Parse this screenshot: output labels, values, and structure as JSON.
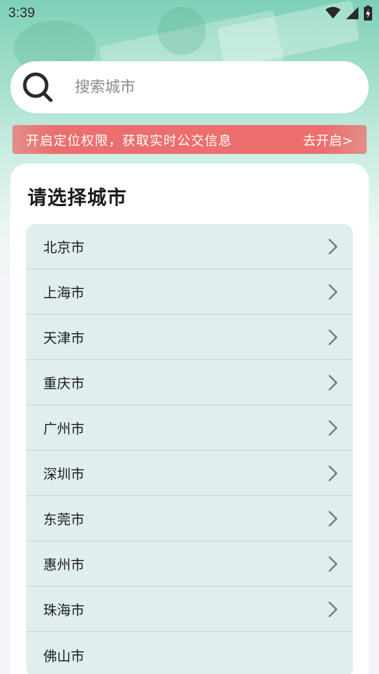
{
  "status": {
    "time": "3:39"
  },
  "search": {
    "placeholder": "搜索城市"
  },
  "banner": {
    "text": "开启定位权限，获取实时公交信息",
    "action": "去开启>"
  },
  "card": {
    "title": "请选择城市"
  },
  "cities": [
    {
      "name": "北京市",
      "chevron": true
    },
    {
      "name": "上海市",
      "chevron": true
    },
    {
      "name": "天津市",
      "chevron": true
    },
    {
      "name": "重庆市",
      "chevron": true
    },
    {
      "name": "广州市",
      "chevron": true
    },
    {
      "name": "深圳市",
      "chevron": true
    },
    {
      "name": "东莞市",
      "chevron": true
    },
    {
      "name": "惠州市",
      "chevron": true
    },
    {
      "name": "珠海市",
      "chevron": true
    },
    {
      "name": "佛山市",
      "chevron": false
    }
  ],
  "colors": {
    "accent_banner": "#ec6e6d",
    "list_bg": "#e0eeed",
    "hero": "#7fd0b8"
  },
  "icons": {
    "search": "search-icon",
    "chevron": "chevron-right-icon",
    "wifi": "wifi-icon",
    "signal": "signal-icon",
    "battery": "battery-charging-icon"
  }
}
